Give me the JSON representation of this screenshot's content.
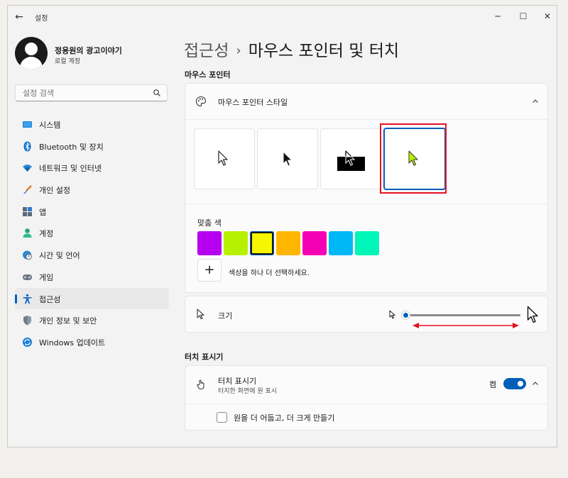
{
  "window": {
    "title": "설정",
    "back": "←",
    "minimize": "─",
    "maximize": "☐",
    "close": "✕"
  },
  "profile": {
    "name": "정용원의 광고이야기",
    "account_type": "로컬 계정"
  },
  "search": {
    "placeholder": "설정 검색"
  },
  "sidebar": {
    "items": [
      {
        "label": "시스템",
        "icon": "system-icon",
        "active": false
      },
      {
        "label": "Bluetooth 및 장치",
        "icon": "bluetooth-icon",
        "active": false
      },
      {
        "label": "네트워크 및 인터넷",
        "icon": "network-icon",
        "active": false
      },
      {
        "label": "개인 설정",
        "icon": "brush-icon",
        "active": false
      },
      {
        "label": "앱",
        "icon": "apps-icon",
        "active": false
      },
      {
        "label": "계정",
        "icon": "account-icon",
        "active": false
      },
      {
        "label": "시간 및 언어",
        "icon": "globe-clock-icon",
        "active": false
      },
      {
        "label": "게임",
        "icon": "gamepad-icon",
        "active": false
      },
      {
        "label": "접근성",
        "icon": "accessibility-icon",
        "active": true
      },
      {
        "label": "개인 정보 및 보안",
        "icon": "shield-icon",
        "active": false
      },
      {
        "label": "Windows 업데이트",
        "icon": "update-icon",
        "active": false
      }
    ]
  },
  "breadcrumb": {
    "parent": "접근성",
    "separator": "›",
    "current": "마우스 포인터 및 터치"
  },
  "pointer_section": {
    "title": "마우스 포인터",
    "style_card": {
      "label": "마우스 포인터 스타일",
      "styles": [
        "white",
        "black",
        "inverted",
        "custom"
      ],
      "selected": "custom",
      "custom_color_label": "맞춤 색",
      "colors": [
        "#b600f0",
        "#b8f100",
        "#f6f600",
        "#ffb600",
        "#f500b5",
        "#00b8f5",
        "#00f5b8"
      ],
      "selected_color": "#f6f600",
      "add_color_label": "색상을 하나 더 선택하세요."
    },
    "size": {
      "label": "크기",
      "value_fraction": 0.0
    }
  },
  "touch_section": {
    "title": "터치 표시기",
    "indicator": {
      "label": "터치 표시기",
      "description": "터치한 화면에 원 표시",
      "state_label": "켬",
      "on": true
    },
    "darker_larger": {
      "label": "원을 더 어둡고, 더 크게 만들기",
      "checked": false
    }
  },
  "colors": {
    "accent": "#005fb8",
    "annotation": "#e81123"
  }
}
